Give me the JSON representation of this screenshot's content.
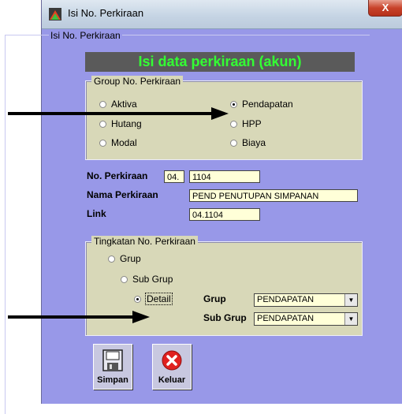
{
  "window": {
    "title": "Isi No. Perkiraan",
    "close_label": "X"
  },
  "outer_group": {
    "legend": "Isi No. Perkiraan"
  },
  "banner": {
    "text": "Isi data perkiraan (akun)"
  },
  "group_no": {
    "legend": "Group No. Perkiraan",
    "options": [
      {
        "label": "Aktiva",
        "selected": false
      },
      {
        "label": "Hutang",
        "selected": false
      },
      {
        "label": "Modal",
        "selected": false
      },
      {
        "label": "Pendapatan",
        "selected": true
      },
      {
        "label": "HPP",
        "selected": false
      },
      {
        "label": "Biaya",
        "selected": false
      }
    ]
  },
  "fields": {
    "no_perkiraan_label": "No. Perkiraan",
    "no_perkiraan_prefix": "04.",
    "no_perkiraan_value": "1104",
    "nama_label": "Nama Perkiraan",
    "nama_value": "PEND PENUTUPAN SIMPANAN",
    "link_label": "Link",
    "link_value": "04.1104"
  },
  "tingkatan": {
    "legend": "Tingkatan No. Perkiraan",
    "options": [
      {
        "label": "Grup",
        "selected": false
      },
      {
        "label": "Sub Grup",
        "selected": false
      },
      {
        "label": "Detail",
        "selected": true
      }
    ],
    "grup_label": "Grup",
    "grup_value": "PENDAPATAN",
    "subgrup_label": "Sub Grup",
    "subgrup_value": "PENDAPATAN"
  },
  "buttons": {
    "simpan": "Simpan",
    "keluar": "Keluar"
  },
  "colors": {
    "window_bg": "#9898e8",
    "banner_text": "#33ff33",
    "groupbox_bg": "#d8d8b8",
    "field_bg": "#ffffd8"
  }
}
